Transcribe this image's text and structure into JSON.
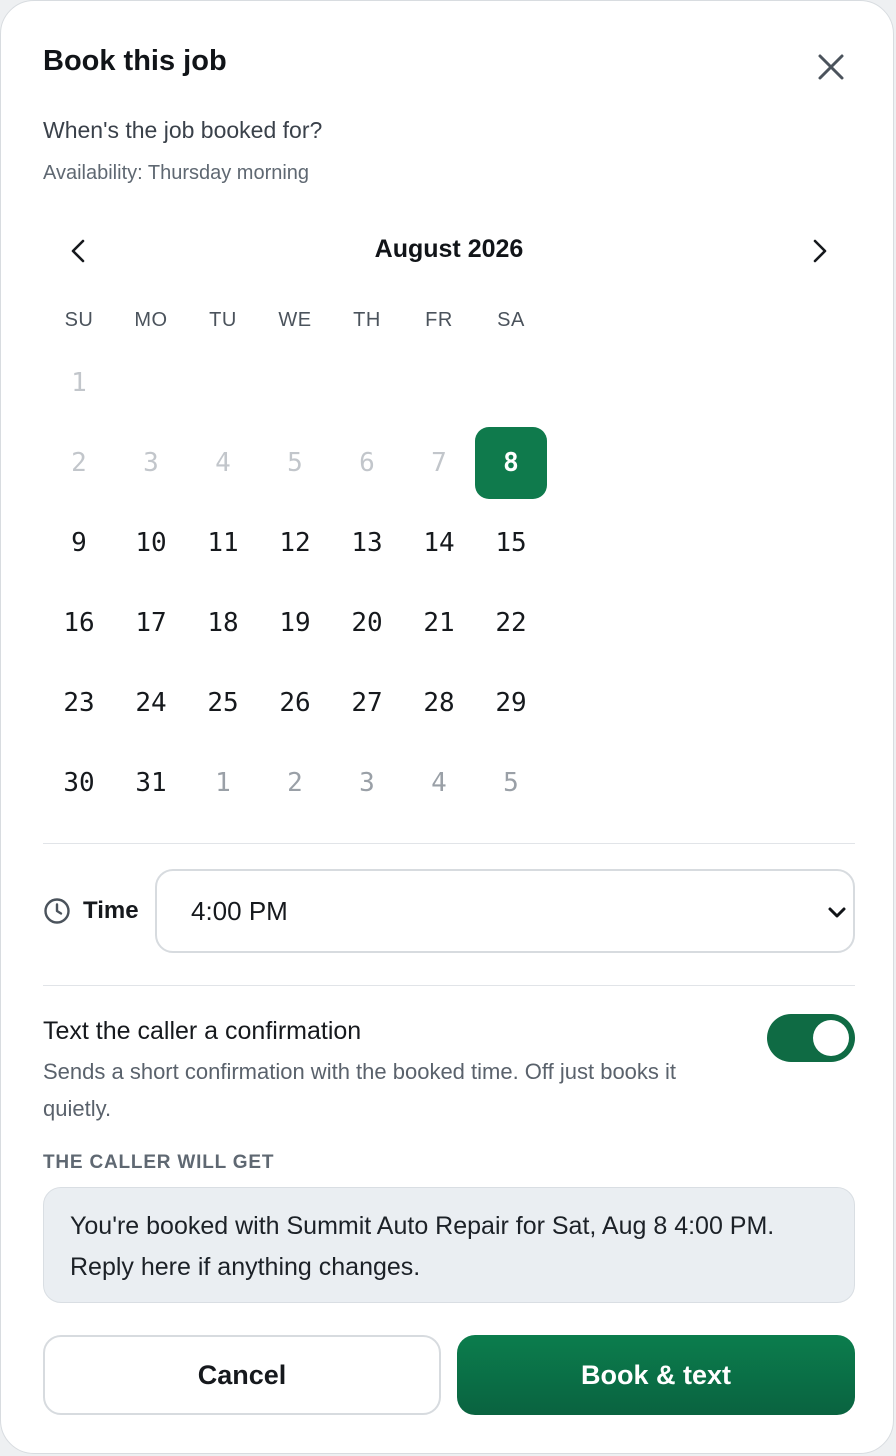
{
  "dialog": {
    "title": "Book this job",
    "question": "When's the job booked for?",
    "availability": "Availability: Thursday morning"
  },
  "calendar": {
    "month_label": "August 2026",
    "weekdays": [
      "SU",
      "MO",
      "TU",
      "WE",
      "TH",
      "FR",
      "SA"
    ],
    "weeks": [
      [
        {
          "d": "1",
          "state": "muted"
        }
      ],
      [
        {
          "d": "2",
          "state": "muted"
        },
        {
          "d": "3",
          "state": "muted"
        },
        {
          "d": "4",
          "state": "muted"
        },
        {
          "d": "5",
          "state": "muted"
        },
        {
          "d": "6",
          "state": "muted"
        },
        {
          "d": "7",
          "state": "muted"
        },
        {
          "d": "8",
          "state": "selected"
        }
      ],
      [
        {
          "d": "9"
        },
        {
          "d": "10"
        },
        {
          "d": "11"
        },
        {
          "d": "12"
        },
        {
          "d": "13"
        },
        {
          "d": "14"
        },
        {
          "d": "15"
        }
      ],
      [
        {
          "d": "16"
        },
        {
          "d": "17"
        },
        {
          "d": "18"
        },
        {
          "d": "19"
        },
        {
          "d": "20"
        },
        {
          "d": "21"
        },
        {
          "d": "22"
        }
      ],
      [
        {
          "d": "23"
        },
        {
          "d": "24"
        },
        {
          "d": "25"
        },
        {
          "d": "26"
        },
        {
          "d": "27"
        },
        {
          "d": "28"
        },
        {
          "d": "29"
        }
      ],
      [
        {
          "d": "30"
        },
        {
          "d": "31"
        },
        {
          "d": "1",
          "state": "out"
        },
        {
          "d": "2",
          "state": "out"
        },
        {
          "d": "3",
          "state": "out"
        },
        {
          "d": "4",
          "state": "out"
        },
        {
          "d": "5",
          "state": "out"
        }
      ]
    ],
    "selected_color": "#0f7a4c"
  },
  "time": {
    "label": "Time",
    "value": "4:00 PM",
    "icon": "clock-icon"
  },
  "confirmation": {
    "title": "Text the caller a confirmation",
    "description": "Sends a short confirmation with the booked time. Off just books it quietly.",
    "enabled": true
  },
  "preview": {
    "label": "THE CALLER WILL GET",
    "message": "You're booked with Summit Auto Repair for Sat, Aug 8 4:00 PM. Reply here if anything changes."
  },
  "actions": {
    "cancel_label": "Cancel",
    "submit_label": "Book & text",
    "accent": "#0b7d4d"
  }
}
